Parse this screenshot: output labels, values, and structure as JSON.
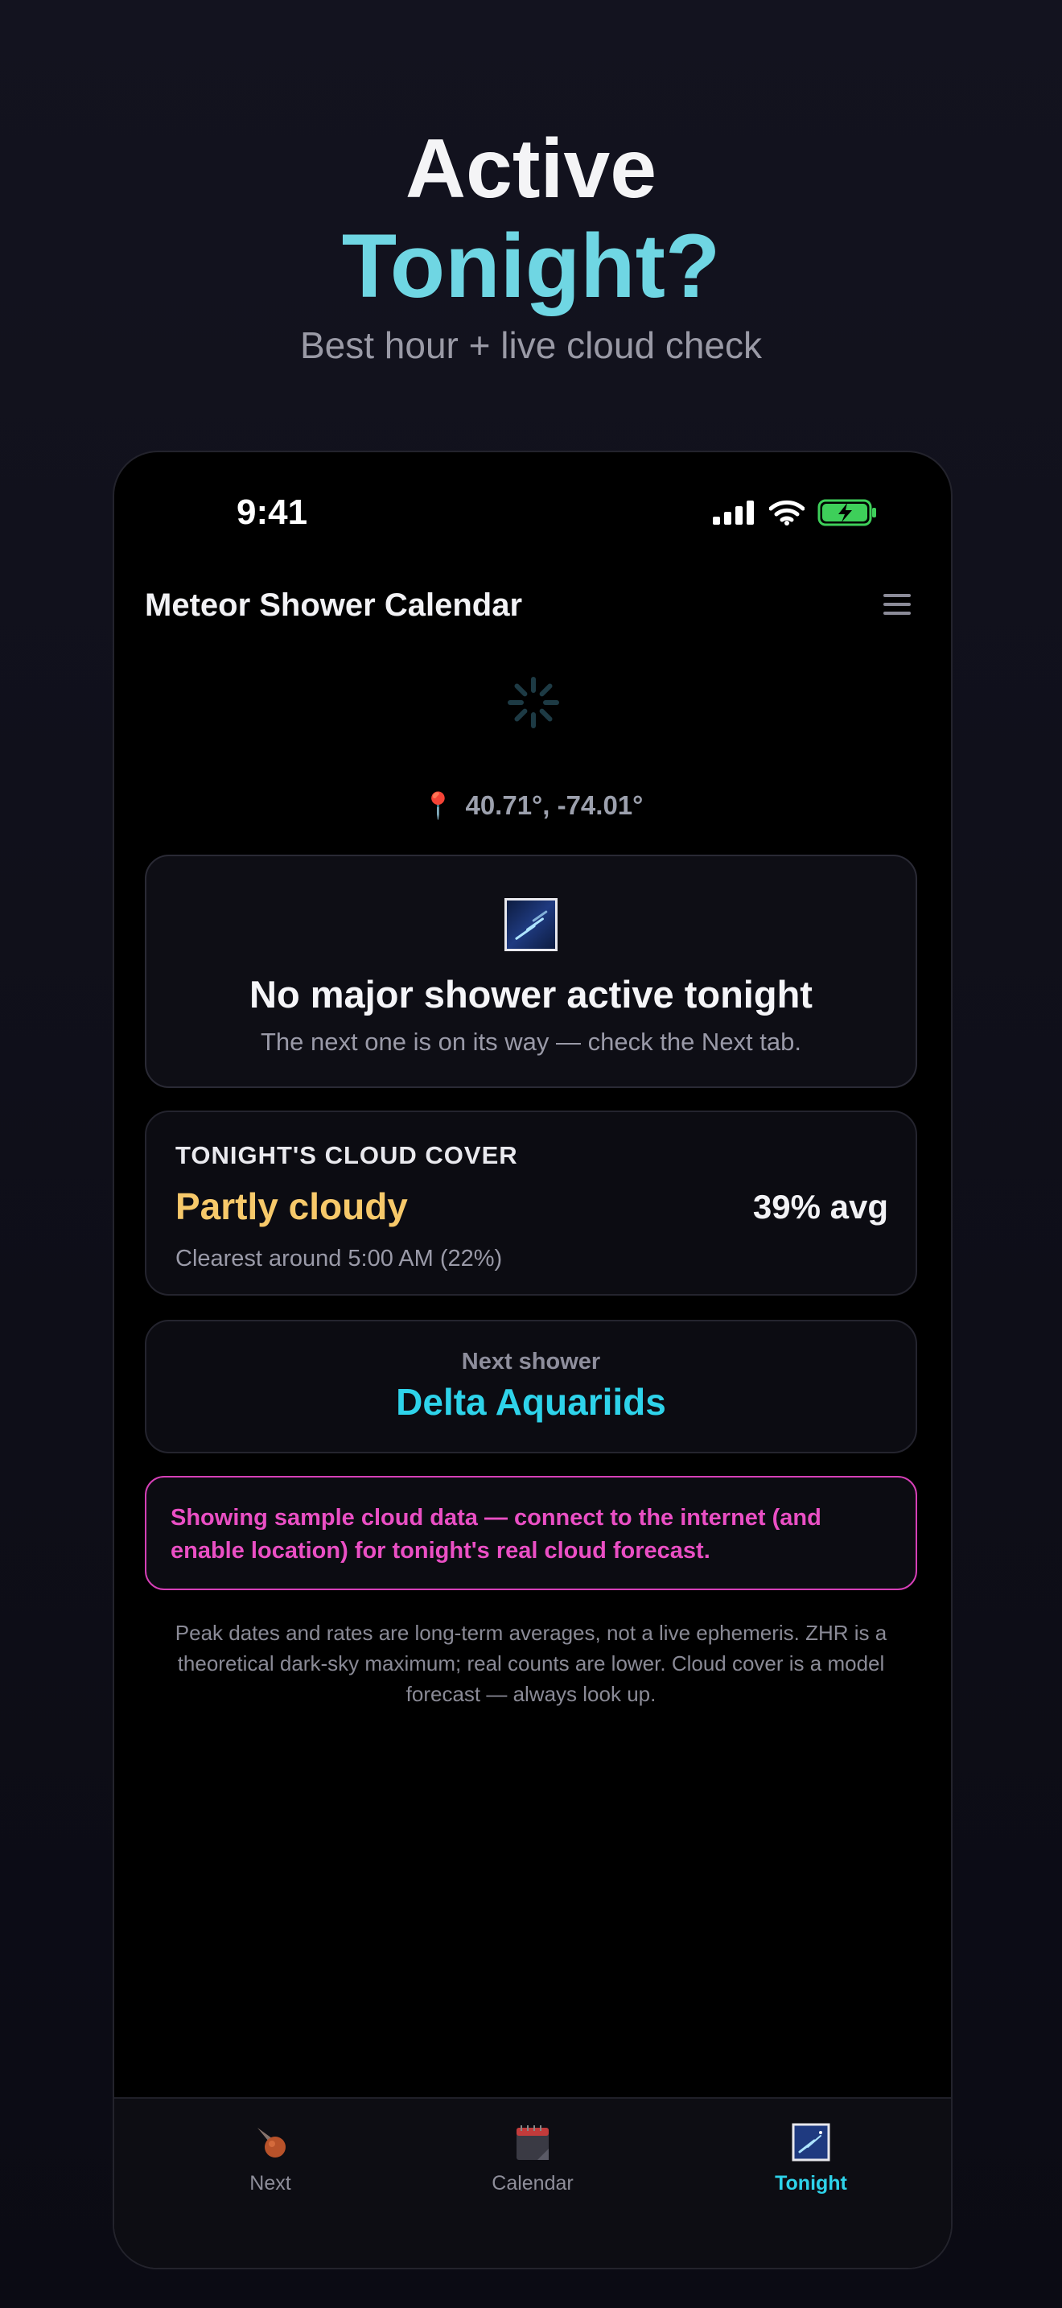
{
  "hero": {
    "line1": "Active",
    "line2": "Tonight?",
    "subtitle": "Best hour + live cloud check"
  },
  "status_bar": {
    "time": "9:41",
    "icons": [
      "signal-icon",
      "wifi-icon",
      "battery-charging-icon"
    ]
  },
  "app": {
    "title": "Meteor Shower Calendar",
    "menu_icon": "hamburger-menu-icon"
  },
  "location": {
    "icon": "pin-icon",
    "coords": "40.71°, -74.01°"
  },
  "shower_card": {
    "icon": "meteor-shower-icon",
    "title": "No major shower active tonight",
    "subtitle": "The next one is on its way — check the Next tab."
  },
  "cloud_card": {
    "label": "TONIGHT'S CLOUD COVER",
    "condition": "Partly cloudy",
    "average": "39% avg",
    "clearest": "Clearest around 5:00 AM (22%)"
  },
  "next_card": {
    "label": "Next shower",
    "name": "Delta Aquariids"
  },
  "warning": {
    "text": "Showing sample cloud data — connect to the internet (and enable location) for tonight's real cloud forecast."
  },
  "disclaimer": "Peak dates and rates are long-term averages, not a live ephemeris. ZHR is a theoretical dark-sky maximum; real counts are lower. Cloud cover is a model forecast — always look up.",
  "tabs": [
    {
      "label": "Next",
      "icon": "comet-icon",
      "active": false
    },
    {
      "label": "Calendar",
      "icon": "calendar-icon",
      "active": false
    },
    {
      "label": "Tonight",
      "icon": "night-sky-icon",
      "active": true
    }
  ],
  "colors": {
    "accent": "#2ed3ea",
    "hero_accent": "#6fd6e3",
    "cloud_condition": "#f7c96a",
    "warning": "#ea4fc4",
    "battery": "#3ecf5a"
  }
}
